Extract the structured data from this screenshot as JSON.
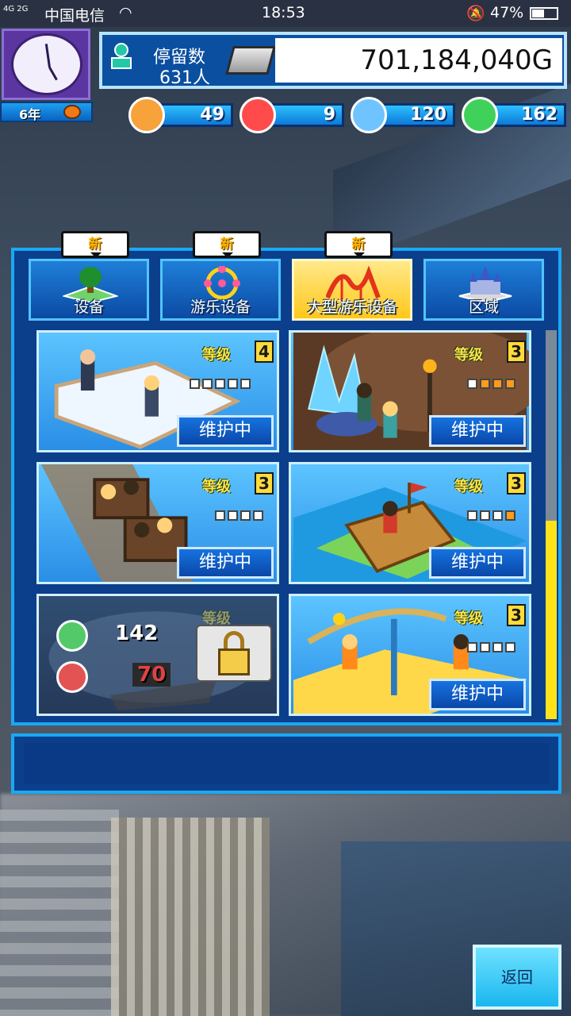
{
  "status_bar": {
    "signal": "4G 2G",
    "carrier": "中国电信",
    "time": "18:53",
    "battery": "47%"
  },
  "calendar": {
    "year": "6年"
  },
  "park": {
    "visitors_label": "停留数",
    "visitors_count": "631人",
    "money": "701,184,040G"
  },
  "resources": [
    {
      "name": "orange-medal-icon",
      "value": "49",
      "color": "#f7a23b"
    },
    {
      "name": "fire-icon",
      "value": "9",
      "color": "#ff4b4b"
    },
    {
      "name": "water-drop-icon",
      "value": "120",
      "color": "#6fc4ff"
    },
    {
      "name": "green-star-icon",
      "value": "162",
      "color": "#3fd15a"
    }
  ],
  "tabs": [
    {
      "label": "设备",
      "badge": "新",
      "active": false
    },
    {
      "label": "游乐设备",
      "badge": "新",
      "active": false
    },
    {
      "label": "大型游乐设备",
      "badge": "新",
      "active": true
    },
    {
      "label": "区域",
      "badge": "",
      "active": false
    }
  ],
  "cards": [
    {
      "level_label": "等级",
      "level": "4",
      "pips_on": 0,
      "pips_total": 5,
      "status": "维护中"
    },
    {
      "level_label": "等级",
      "level": "3",
      "pips_on": 3,
      "pips_total": 4,
      "status": "维护中"
    },
    {
      "level_label": "等级",
      "level": "3",
      "pips_on": 0,
      "pips_total": 4,
      "status": "维护中"
    },
    {
      "level_label": "等级",
      "level": "3",
      "pips_on": 1,
      "pips_total": 4,
      "status": "维护中"
    },
    {
      "level_label": "等级",
      "locked": true,
      "cost_green": "142",
      "cost_red": "70"
    },
    {
      "level_label": "等级",
      "level": "3",
      "pips_on": 0,
      "pips_total": 4,
      "status": "维护中"
    }
  ],
  "back_button": "返回"
}
